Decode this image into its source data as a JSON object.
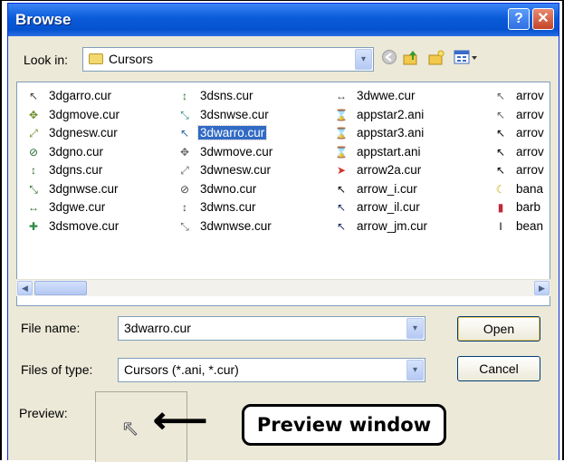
{
  "window": {
    "title": "Browse",
    "help_glyph": "?",
    "close_glyph": "✕"
  },
  "lookin": {
    "label": "Look in:",
    "value": "Cursors"
  },
  "toolbar": {
    "dropdown_glyph": "▾"
  },
  "files": [
    {
      "name": "3dgarro.cur",
      "icon": "arrow-cursor-icon",
      "glyph": "↖",
      "color": "#444"
    },
    {
      "name": "3dgmove.cur",
      "icon": "move-cursor-icon",
      "glyph": "✥",
      "color": "#6a8a24"
    },
    {
      "name": "3dgnesw.cur",
      "icon": "diag-resize-icon",
      "glyph": "⤢",
      "color": "#6a8a24"
    },
    {
      "name": "3dgno.cur",
      "icon": "no-cursor-icon",
      "glyph": "⊘",
      "color": "#2c6a2c"
    },
    {
      "name": "3dgns.cur",
      "icon": "ns-resize-icon",
      "glyph": "↕",
      "color": "#2c6a2c"
    },
    {
      "name": "3dgnwse.cur",
      "icon": "diag-resize-icon",
      "glyph": "⤡",
      "color": "#2c6a2c"
    },
    {
      "name": "3dgwe.cur",
      "icon": "we-resize-icon",
      "glyph": "↔",
      "color": "#2c6a2c"
    },
    {
      "name": "3dsmove.cur",
      "icon": "move-cursor-icon",
      "glyph": "✚",
      "color": "#2e8a4a"
    },
    {
      "name": "3dsns.cur",
      "icon": "ns-resize-icon",
      "glyph": "↕",
      "color": "#2c6a2c"
    },
    {
      "name": "3dsnwse.cur",
      "icon": "diag-resize-icon",
      "glyph": "⤡",
      "color": "#2e8a8a"
    },
    {
      "name": "3dwarro.cur",
      "icon": "arrow-cursor-icon",
      "glyph": "↖",
      "color": "#2e6aa0",
      "selected": true
    },
    {
      "name": "3dwmove.cur",
      "icon": "move-cursor-icon",
      "glyph": "✥",
      "color": "#666"
    },
    {
      "name": "3dwnesw.cur",
      "icon": "diag-resize-icon",
      "glyph": "⤢",
      "color": "#666"
    },
    {
      "name": "3dwno.cur",
      "icon": "no-cursor-icon",
      "glyph": "⊘",
      "color": "#444"
    },
    {
      "name": "3dwns.cur",
      "icon": "ns-resize-icon",
      "glyph": "↕",
      "color": "#444"
    },
    {
      "name": "3dwnwse.cur",
      "icon": "diag-resize-icon",
      "glyph": "⤡",
      "color": "#666"
    },
    {
      "name": "3dwwe.cur",
      "icon": "we-resize-icon",
      "glyph": "↔",
      "color": "#444"
    },
    {
      "name": "appstar2.ani",
      "icon": "busy-cursor-icon",
      "glyph": "⌛",
      "color": "#555"
    },
    {
      "name": "appstar3.ani",
      "icon": "busy-cursor-icon",
      "glyph": "⌛",
      "color": "#555"
    },
    {
      "name": "appstart.ani",
      "icon": "busy-cursor-icon",
      "glyph": "⌛",
      "color": "#555"
    },
    {
      "name": "arrow2a.cur",
      "icon": "red-arrow-icon",
      "glyph": "➤",
      "color": "#d0342c"
    },
    {
      "name": "arrow_i.cur",
      "icon": "arrow-cursor-icon",
      "glyph": "↖",
      "color": "#000"
    },
    {
      "name": "arrow_il.cur",
      "icon": "arrow-cursor-icon",
      "glyph": "↖",
      "color": "#1a2a6a"
    },
    {
      "name": "arrow_jm.cur",
      "icon": "arrow-cursor-icon",
      "glyph": "↖",
      "color": "#1a2a6a"
    },
    {
      "name": "arrov",
      "icon": "arrow-cursor-icon",
      "glyph": "↖",
      "color": "#666"
    },
    {
      "name": "arrov",
      "icon": "arrow-cursor-icon",
      "glyph": "↖",
      "color": "#666"
    },
    {
      "name": "arrov",
      "icon": "arrow-cursor-icon",
      "glyph": "↖",
      "color": "#000"
    },
    {
      "name": "arrov",
      "icon": "arrow-cursor-icon",
      "glyph": "↖",
      "color": "#000"
    },
    {
      "name": "arrov",
      "icon": "arrow-cursor-icon",
      "glyph": "↖",
      "color": "#000"
    },
    {
      "name": "bana",
      "icon": "banana-cursor-icon",
      "glyph": "☾",
      "color": "#c8a800"
    },
    {
      "name": "barb",
      "icon": "barber-cursor-icon",
      "glyph": "▮",
      "color": "#c0283a"
    },
    {
      "name": "bean",
      "icon": "beam-cursor-icon",
      "glyph": "I",
      "color": "#000"
    }
  ],
  "scroll": {
    "left_glyph": "◀",
    "right_glyph": "▶"
  },
  "filename": {
    "label": "File name:",
    "value": "3dwarro.cur"
  },
  "filetype": {
    "label": "Files of type:",
    "value": "Cursors (*.ani, *.cur)"
  },
  "buttons": {
    "open": "Open",
    "cancel": "Cancel"
  },
  "preview": {
    "label": "Preview:",
    "cursor_glyph": "↖",
    "callout_text": "Preview window",
    "arrow_glyph": "⟵"
  }
}
